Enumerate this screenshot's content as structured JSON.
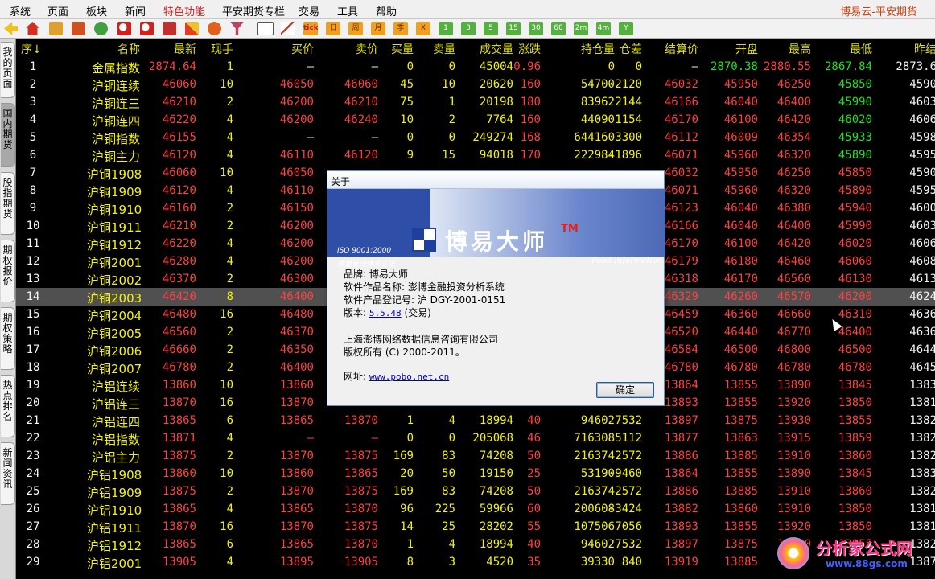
{
  "menu": {
    "items": [
      "系统",
      "页面",
      "板块",
      "新闻",
      "特色功能",
      "平安期货专栏",
      "交易",
      "工具",
      "帮助"
    ],
    "highlight_index": 4,
    "brand": "博易云-平安期货"
  },
  "toolbar": {
    "period_buttons": [
      "日",
      "周",
      "月",
      "季",
      "X"
    ],
    "minute_buttons": [
      "1",
      "3",
      "5",
      "15",
      "30",
      "60",
      "2m",
      "4m",
      "Y"
    ]
  },
  "side_tabs": [
    {
      "label": "我的页面",
      "active": false
    },
    {
      "label": "国内期货",
      "active": true
    },
    {
      "label": "股指期货",
      "active": false
    },
    {
      "label": "期权报价",
      "active": false
    },
    {
      "label": "期权策略",
      "active": false
    },
    {
      "label": "热点排名",
      "active": false
    },
    {
      "label": "新闻资讯",
      "active": false
    }
  ],
  "table": {
    "headers": [
      "序↓",
      "名称",
      "最新",
      "现手",
      "买价",
      "卖价",
      "买量",
      "卖量",
      "成交量",
      "涨跌",
      "持仓量",
      "仓差",
      "结算价",
      "开盘",
      "最高",
      "最低",
      "昨结"
    ],
    "selected_index": 13,
    "rows": [
      [
        "1",
        "金属指数",
        "2874.64",
        "1",
        "—",
        "—",
        "0",
        "0",
        "45004",
        "0.96",
        "0",
        "0",
        "—",
        "2870.38",
        "2880.55",
        "2867.84",
        "2873.6"
      ],
      [
        "2",
        "沪铜连续",
        "46060",
        "10",
        "46050",
        "46060",
        "45",
        "10",
        "20620",
        "160",
        "54700",
        "-2120",
        "46032",
        "45950",
        "46250",
        "45850",
        "4590"
      ],
      [
        "3",
        "沪铜连三",
        "46210",
        "2",
        "46200",
        "46210",
        "75",
        "1",
        "20198",
        "180",
        "83962",
        "2144",
        "46166",
        "46040",
        "46400",
        "45990",
        "4603"
      ],
      [
        "4",
        "沪铜连四",
        "46220",
        "4",
        "46200",
        "46240",
        "10",
        "2",
        "7764",
        "160",
        "44090",
        "1154",
        "46170",
        "46100",
        "46420",
        "46020",
        "4606"
      ],
      [
        "5",
        "沪铜指数",
        "46155",
        "4",
        "—",
        "—",
        "0",
        "0",
        "249274",
        "168",
        "644160",
        "3300",
        "46112",
        "46009",
        "46354",
        "45933",
        "4598"
      ],
      [
        "6",
        "沪铜主力",
        "46120",
        "4",
        "46110",
        "46120",
        "9",
        "15",
        "94018",
        "170",
        "222984",
        "-1896",
        "46071",
        "45960",
        "46320",
        "45890",
        "4595"
      ],
      [
        "7",
        "沪铜1908",
        "46060",
        "10",
        "46050",
        "",
        "",
        "",
        "",
        "",
        "",
        "",
        "46032",
        "45950",
        "46250",
        "45850",
        "4590"
      ],
      [
        "8",
        "沪铜1909",
        "46120",
        "4",
        "46110",
        "",
        "",
        "",
        "",
        "",
        "",
        "",
        "46071",
        "45960",
        "46320",
        "45890",
        "4595"
      ],
      [
        "9",
        "沪铜1910",
        "46160",
        "2",
        "46150",
        "",
        "",
        "",
        "",
        "",
        "",
        "",
        "46123",
        "46040",
        "46380",
        "45940",
        "4600"
      ],
      [
        "10",
        "沪铜1911",
        "46210",
        "2",
        "46200",
        "",
        "",
        "",
        "",
        "",
        "",
        "",
        "46166",
        "46040",
        "46400",
        "45990",
        "4603"
      ],
      [
        "11",
        "沪铜1912",
        "46220",
        "4",
        "46200",
        "",
        "",
        "",
        "",
        "",
        "",
        "",
        "46170",
        "46100",
        "46420",
        "46020",
        "4606"
      ],
      [
        "12",
        "沪铜2001",
        "46280",
        "4",
        "46200",
        "",
        "",
        "",
        "",
        "",
        "",
        "",
        "46179",
        "46180",
        "46460",
        "46060",
        "4608"
      ],
      [
        "13",
        "沪铜2002",
        "46370",
        "2",
        "46300",
        "",
        "",
        "",
        "",
        "",
        "",
        "",
        "46318",
        "46170",
        "46560",
        "46130",
        "4613"
      ],
      [
        "14",
        "沪铜2003",
        "46420",
        "8",
        "46400",
        "",
        "",
        "",
        "",
        "",
        "",
        "",
        "46329",
        "46260",
        "46570",
        "46200",
        "4624"
      ],
      [
        "15",
        "沪铜2004",
        "46480",
        "16",
        "46480",
        "",
        "",
        "",
        "",
        "",
        "",
        "",
        "46459",
        "46360",
        "46660",
        "46310",
        "4636"
      ],
      [
        "16",
        "沪铜2005",
        "46560",
        "2",
        "46370",
        "",
        "",
        "",
        "",
        "",
        "",
        "",
        "46520",
        "46440",
        "46770",
        "46400",
        "4636"
      ],
      [
        "17",
        "沪铜2006",
        "46660",
        "2",
        "46350",
        "",
        "",
        "",
        "",
        "",
        "",
        "",
        "46584",
        "46500",
        "46800",
        "46500",
        "4644"
      ],
      [
        "18",
        "沪铜2007",
        "46780",
        "2",
        "46400",
        "",
        "",
        "",
        "",
        "",
        "",
        "",
        "46780",
        "46780",
        "46780",
        "46780",
        "4645"
      ],
      [
        "19",
        "沪铝连续",
        "13860",
        "10",
        "13860",
        "",
        "",
        "",
        "",
        "",
        "",
        "",
        "13864",
        "13855",
        "13890",
        "13845",
        "1383"
      ],
      [
        "20",
        "沪铝连三",
        "13870",
        "16",
        "13870",
        "",
        "",
        "",
        "",
        "",
        "",
        "",
        "13893",
        "13855",
        "13920",
        "13850",
        "1381"
      ],
      [
        "21",
        "沪铝连四",
        "13865",
        "6",
        "13865",
        "13870",
        "1",
        "4",
        "18994",
        "40",
        "94602",
        "7532",
        "13897",
        "13875",
        "13930",
        "13855",
        "1382"
      ],
      [
        "22",
        "沪铝指数",
        "13871",
        "4",
        "—",
        "—",
        "0",
        "0",
        "205068",
        "46",
        "716308",
        "5112",
        "13877",
        "13863",
        "13915",
        "13859",
        "1382"
      ],
      [
        "23",
        "沪铝主力",
        "13875",
        "2",
        "13870",
        "13875",
        "169",
        "83",
        "74208",
        "50",
        "216374",
        "2572",
        "13886",
        "13885",
        "13910",
        "13860",
        "1382"
      ],
      [
        "24",
        "沪铝1908",
        "13860",
        "10",
        "13860",
        "13865",
        "20",
        "50",
        "19150",
        "25",
        "53190",
        "-9460",
        "13864",
        "13855",
        "13890",
        "13845",
        "1383"
      ],
      [
        "25",
        "沪铝1909",
        "13875",
        "2",
        "13870",
        "13875",
        "169",
        "83",
        "74208",
        "50",
        "216374",
        "2572",
        "13886",
        "13885",
        "13910",
        "13860",
        "1382"
      ],
      [
        "26",
        "沪铝1910",
        "13865",
        "4",
        "13865",
        "13870",
        "96",
        "225",
        "59966",
        "60",
        "200608",
        "-3424",
        "13882",
        "13860",
        "13910",
        "13850",
        "1381"
      ],
      [
        "27",
        "沪铝1911",
        "13870",
        "16",
        "13870",
        "13875",
        "14",
        "25",
        "28202",
        "55",
        "107506",
        "7056",
        "13893",
        "13855",
        "13920",
        "13850",
        "1381"
      ],
      [
        "28",
        "沪铝1912",
        "13865",
        "6",
        "13865",
        "13870",
        "1",
        "4",
        "18994",
        "40",
        "94602",
        "7532",
        "13897",
        "13875",
        "13930",
        "13855",
        "1382"
      ],
      [
        "29",
        "沪铝2001",
        "13905",
        "4",
        "13895",
        "13905",
        "8",
        "3",
        "4520",
        "35",
        "39330",
        "840",
        "13919",
        "13885",
        "",
        "",
        "1387"
      ]
    ],
    "cell_colors": [
      [
        "y",
        "y",
        "r",
        "y",
        "w",
        "w",
        "y",
        "y",
        "y",
        "r",
        "y",
        "y",
        "w",
        "g",
        "r",
        "g",
        "w"
      ],
      [
        "y",
        "y",
        "r",
        "y",
        "r",
        "r",
        "y",
        "y",
        "y",
        "r",
        "y",
        "y",
        "r",
        "r",
        "r",
        "g",
        "w"
      ],
      [
        "y",
        "y",
        "r",
        "y",
        "r",
        "r",
        "y",
        "y",
        "y",
        "r",
        "y",
        "y",
        "r",
        "r",
        "r",
        "g",
        "w"
      ],
      [
        "y",
        "y",
        "r",
        "y",
        "r",
        "r",
        "y",
        "y",
        "y",
        "r",
        "y",
        "y",
        "r",
        "r",
        "r",
        "g",
        "w"
      ],
      [
        "y",
        "y",
        "r",
        "y",
        "w",
        "w",
        "y",
        "y",
        "y",
        "r",
        "y",
        "y",
        "r",
        "r",
        "r",
        "g",
        "w"
      ],
      [
        "y",
        "y",
        "r",
        "y",
        "r",
        "r",
        "y",
        "y",
        "y",
        "r",
        "y",
        "y",
        "r",
        "r",
        "r",
        "g",
        "w"
      ]
    ]
  },
  "dialog": {
    "title": "关于",
    "banner_name": "博易大师",
    "banner_tm": "TM",
    "banner_iso": "ISO 9001:2000",
    "banner_iso_cn": "质量管理体系认证",
    "banner_en": "Pobo Information",
    "brand_line": "品牌: 博易大师",
    "product_line": "软件作品名称: 澎博金融投资分析系统",
    "reg_line": "软件产品登记号: 沪 DGY-2001-0151",
    "version_label": "版本:",
    "version_value": "5.5.48",
    "version_suffix": "(交易)",
    "company_line": "上海澎博网络数据信息咨询有限公司",
    "copyright_line": "版权所有 (C) 2000-2011。",
    "url_label": "网址:",
    "url_value": "www.pobo.net.cn",
    "ok_label": "确定"
  },
  "watermark": {
    "title": "分析家公式网",
    "url": "www.88gs.com"
  }
}
